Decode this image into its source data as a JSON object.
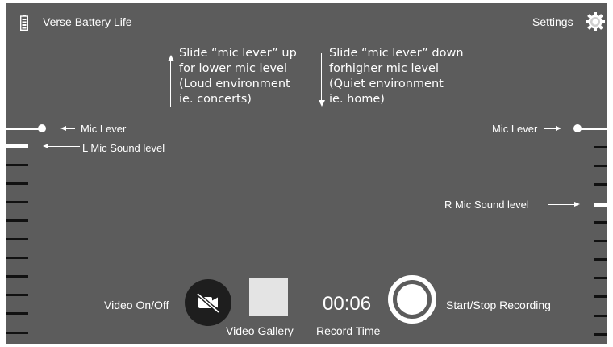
{
  "header": {
    "battery_label": "Verse Battery Life",
    "settings_label": "Settings",
    "battery_icon": "battery-icon",
    "settings_icon": "gear-icon"
  },
  "notes": {
    "up_line1": "Slide “mic lever” up",
    "up_line2": "for lower mic level",
    "up_line3": "(Loud environment",
    "up_line4": "ie. concerts)",
    "down_line1": "Slide “mic lever” down",
    "down_line2": "forhigher mic level",
    "down_line3": "(Quiet environment",
    "down_line4": "ie. home)"
  },
  "left": {
    "mic_lever_label": "Mic Lever",
    "sound_level_label": "L Mic Sound level"
  },
  "right": {
    "mic_lever_label": "Mic Lever",
    "sound_level_label": "R Mic Sound level"
  },
  "controls": {
    "video_toggle_label": "Video On/Off",
    "gallery_label": "Video Gallery",
    "record_time": "00:06",
    "record_time_label": "Record Time",
    "record_label": "Start/Stop Recording",
    "video_icon": "video-off-icon"
  },
  "colors": {
    "background": "#5c5c5c",
    "ticks": "#111111",
    "foreground": "#ffffff"
  }
}
